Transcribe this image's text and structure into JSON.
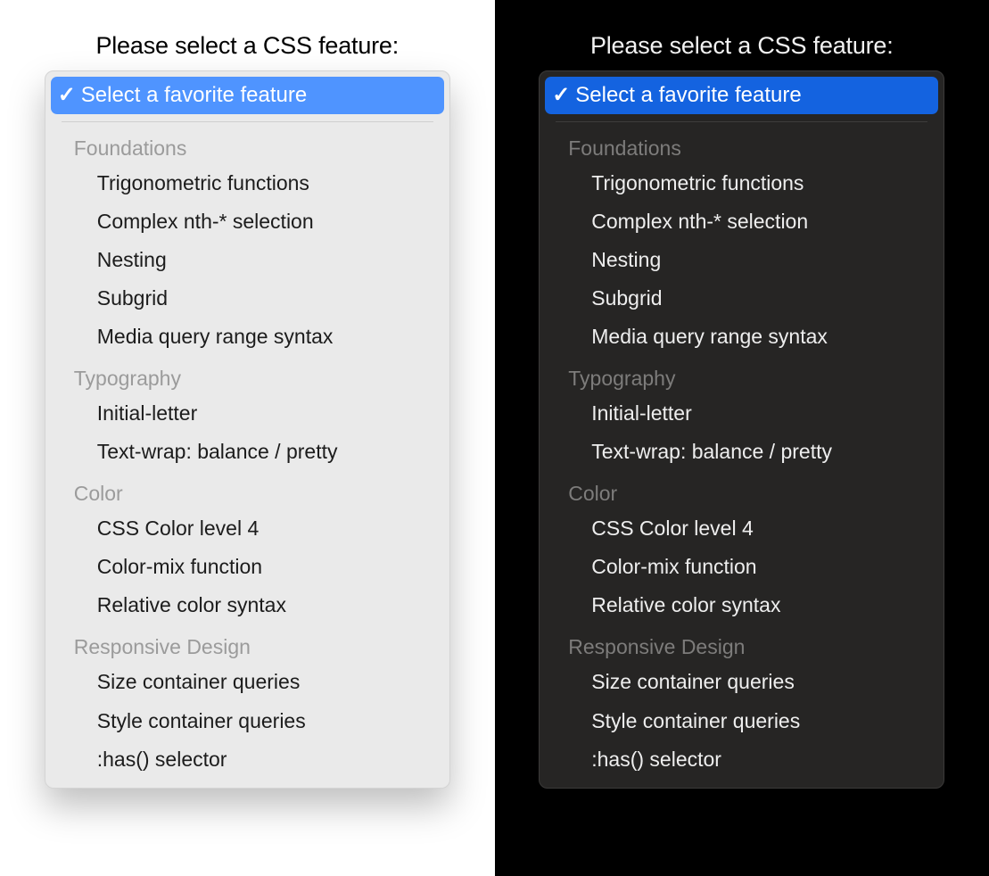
{
  "prompt": "Please select a CSS feature:",
  "selected": "Select a favorite feature",
  "colors": {
    "light_accent": "#4f94ff",
    "dark_accent": "#1463e0"
  },
  "groups": [
    {
      "label": "Foundations",
      "options": [
        "Trigonometric functions",
        "Complex nth-* selection",
        "Nesting",
        "Subgrid",
        "Media query range syntax"
      ]
    },
    {
      "label": "Typography",
      "options": [
        "Initial-letter",
        "Text-wrap: balance / pretty"
      ]
    },
    {
      "label": "Color",
      "options": [
        "CSS Color level 4",
        "Color-mix function",
        "Relative color syntax"
      ]
    },
    {
      "label": "Responsive Design",
      "options": [
        "Size container queries",
        "Style container queries",
        ":has() selector"
      ]
    }
  ]
}
